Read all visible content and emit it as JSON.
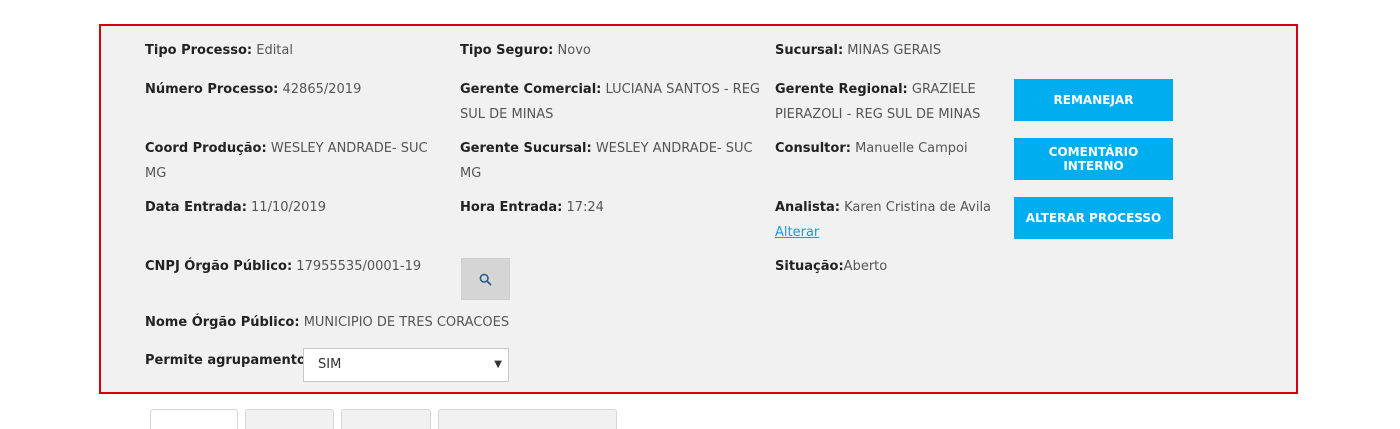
{
  "fields": {
    "tipo_processo": {
      "label": "Tipo Processo:",
      "value": "Edital"
    },
    "tipo_seguro": {
      "label": "Tipo Seguro:",
      "value": "Novo"
    },
    "sucursal": {
      "label": "Sucursal:",
      "value": "MINAS GERAIS"
    },
    "numero_processo": {
      "label": "Número Processo:",
      "value": "42865/2019"
    },
    "gerente_comercial": {
      "label": "Gerente Comercial:",
      "value": "LUCIANA SANTOS - REG",
      "value2": "SUL DE MINAS"
    },
    "gerente_regional": {
      "label": "Gerente Regional:",
      "value": "GRAZIELE",
      "value2": "PIERAZOLI - REG SUL DE MINAS"
    },
    "coord_producao": {
      "label": "Coord Produção:",
      "value": "WESLEY ANDRADE- SUC",
      "value2": "MG"
    },
    "gerente_sucursal": {
      "label": "Gerente Sucursal:",
      "value": "WESLEY ANDRADE- SUC",
      "value2": "MG"
    },
    "consultor": {
      "label": "Consultor:",
      "value": "Manuelle Campoi"
    },
    "data_entrada": {
      "label": "Data Entrada:",
      "value": "11/10/2019"
    },
    "hora_entrada": {
      "label": "Hora Entrada:",
      "value": "17:24"
    },
    "analista": {
      "label": "Analista:",
      "value": "Karen Cristina de Avila",
      "link": "Alterar"
    },
    "cnpj": {
      "label": "CNPJ Órgão Público:",
      "value": "17955535/0001-19"
    },
    "situacao": {
      "label": "Situação:",
      "value": "Aberto"
    },
    "nome_orgao": {
      "label": "Nome Órgão Público:",
      "value": "MUNICIPIO DE TRES CORACOES"
    },
    "permite_agrupamento": {
      "label": "Permite agrupamento:",
      "selected": "SIM"
    }
  },
  "buttons": {
    "remanejar": "REMANEJAR",
    "comentario_interno": "COMENTÁRIO INTERNO",
    "alterar_processo": "ALTERAR PROCESSO"
  },
  "colors": {
    "panel_border": "#d9000d",
    "button": "#00aeef",
    "link": "#1a9ad9"
  }
}
